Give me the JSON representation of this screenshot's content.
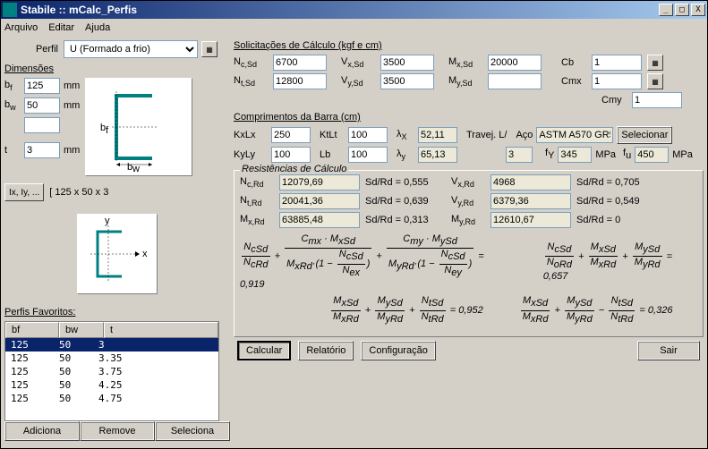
{
  "title": "Stabile :: mCalc_Perfis",
  "menubar": {
    "arquivo": "Arquivo",
    "editar": "Editar",
    "ajuda": "Ajuda"
  },
  "perfil": {
    "label": "Perfil",
    "value": "U (Formado a frio)"
  },
  "dimensoes": {
    "title": "Dimensões",
    "bf": "125",
    "bw": "50",
    "extra": "",
    "t": "3",
    "unit": "mm"
  },
  "props": {
    "btn": "Ix, Iy, ...",
    "text": "[ 125 x 50 x 3"
  },
  "favs": {
    "title": "Perfis Favoritos:",
    "headers": {
      "bf": "bf",
      "bw": "bw",
      "t": "t"
    },
    "rows": [
      {
        "bf": "125",
        "bw": "50",
        "t": "3"
      },
      {
        "bf": "125",
        "bw": "50",
        "t": "3.35"
      },
      {
        "bf": "125",
        "bw": "50",
        "t": "3.75"
      },
      {
        "bf": "125",
        "bw": "50",
        "t": "4.25"
      },
      {
        "bf": "125",
        "bw": "50",
        "t": "4.75"
      }
    ],
    "selected": 0,
    "btns": {
      "add": "Adiciona",
      "remove": "Remove",
      "select": "Seleciona"
    }
  },
  "solicitacoes": {
    "title": "Solicitações de Cálculo (kgf e cm)",
    "ncsd": "6700",
    "vxsd": "3500",
    "mxsd": "20000",
    "cb": "1",
    "ntsd": "12800",
    "vysd": "3500",
    "mysd": "",
    "cmx": "1",
    "cmy": "1"
  },
  "comprimentos": {
    "title": "Comprimentos da Barra (cm)",
    "kxlx": "250",
    "ktlt": "100",
    "lx": "52,11",
    "travej": "Travej. L/",
    "travejval": "3",
    "kyly": "100",
    "lb": "100",
    "ly": "65,13",
    "aco": "Aço",
    "acoval": "ASTM A570 GR5",
    "selecionar": "Selecionar",
    "fy": "345",
    "fu": "450",
    "mpa": "MPa"
  },
  "resistencias": {
    "title": "Resistências de Cálculo",
    "ncrd": "12079,69",
    "sdrd1": "Sd/Rd = 0,555",
    "vxrd": "4968",
    "sdrd4": "Sd/Rd = 0,705",
    "ntrd": "20041,36",
    "sdrd2": "Sd/Rd = 0,639",
    "vyrd": "6379,36",
    "sdrd5": "Sd/Rd = 0,549",
    "mxrd": "63885,48",
    "sdrd3": "Sd/Rd = 0,313",
    "myrd": "12610,67",
    "sdrd6": "Sd/Rd = 0",
    "eq1": "0,919",
    "eq2": "0,657",
    "eq3": "0,952",
    "eq4": "0,326"
  },
  "buttons": {
    "calcular": "Calcular",
    "relatorio": "Relatório",
    "config": "Configuração",
    "sair": "Sair"
  },
  "labels": {
    "ncsd": "N",
    "ncsub": "c,Sd",
    "vxsd": "V",
    "vxsub": "x,Sd",
    "mxsd": "M",
    "mxsub": "x,Sd",
    "ntsd": "N",
    "ntsub": "t,Sd",
    "vysd": "V",
    "vysub": "y,Sd",
    "mysd": "M",
    "mysub": "y,Sd",
    "cb": "Cb",
    "cmx": "Cmx",
    "cmy": "Cmy",
    "kxlx": "KxLx",
    "ktlt": "KtLt",
    "lx": "λ",
    "lxsub": "X",
    "kyly": "KyLy",
    "lb": "Lb",
    "ly": "λ",
    "lysub": "y",
    "fy": "f",
    "fysub": "Y",
    "fu": "f",
    "fusub": "u",
    "ncrd": "N",
    "ncrdsub": "c,Rd",
    "ntrd": "N",
    "ntrdsub": "t,Rd",
    "mxrd": "M",
    "mxrdsub": "x,Rd",
    "vxrd": "V",
    "vxrdsub": "x,Rd",
    "vyrd": "V",
    "vyrdsub": "y,Rd",
    "myrd": "M",
    "myrdsub": "y,Rd",
    "bf": "b",
    "bfsub": "f",
    "bw": "b",
    "bwsub": "w",
    "t": "t"
  }
}
